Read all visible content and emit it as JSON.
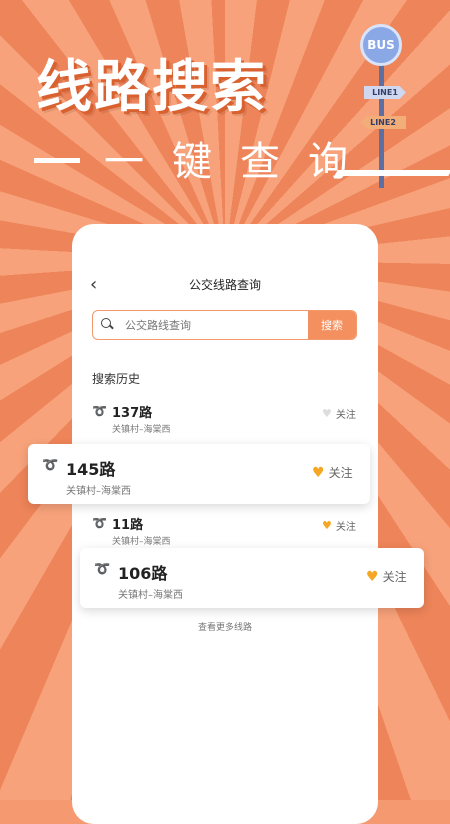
{
  "hero": {
    "headline": "线路搜索",
    "subline": "一键查询"
  },
  "sign": {
    "bus": "BUS",
    "line1": "LINE1",
    "line2": "LINE2"
  },
  "screen": {
    "back_icon": "chevron-left-icon",
    "title": "公交线路查询",
    "search": {
      "placeholder": "公交路线查询",
      "button": "搜索"
    },
    "history_title": "搜索历史",
    "routes": [
      {
        "name": "137路",
        "stops": "关镇村–海棠西",
        "follow": "关注",
        "followed": false
      },
      {
        "name": "145路",
        "stops": "关镇村–海棠西",
        "follow": "关注",
        "followed": true
      },
      {
        "name": "11路",
        "stops": "关镇村–海棠西",
        "follow": "关注",
        "followed": true
      },
      {
        "name": "106路",
        "stops": "关镇村–海棠西",
        "follow": "关注",
        "followed": true
      }
    ],
    "more": "查看更多线路"
  },
  "colors": {
    "accent": "#f4905f",
    "heart_on": "#f5a623",
    "heart_off": "#dddddd"
  }
}
